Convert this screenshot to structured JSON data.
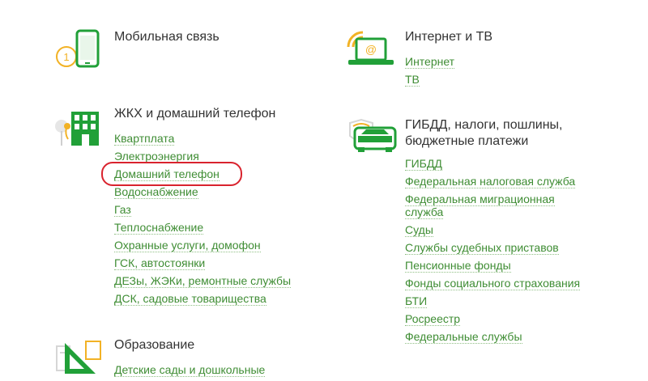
{
  "colors": {
    "accent": "#3f8d34",
    "icon_green": "#21a038",
    "icon_orange": "#f2b225",
    "highlight": "#d9232e",
    "title": "#333333"
  },
  "categories": {
    "mobile": {
      "title": "Мобильная связь",
      "icon": "mobile-phone-icon"
    },
    "internet": {
      "title": "Интернет и ТВ",
      "icon": "laptop-wifi-icon",
      "links": [
        "Интернет",
        "ТВ"
      ]
    },
    "housing": {
      "title": "ЖКХ и домашний телефон",
      "icon": "house-icon",
      "links": [
        "Квартплата",
        "Электроэнергия",
        "Домашний телефон",
        "Водоснабжение",
        "Газ",
        "Теплоснабжение",
        "Охранные услуги, домофон",
        "ГСК, автостоянки",
        "ДЕЗы, ЖЭКи, ремонтные службы",
        "ДСК, садовые товарищества"
      ],
      "highlighted_link": "Домашний телефон"
    },
    "gibdd": {
      "title_line1": "ГИБДД, налоги, пошлины,",
      "title_line2": "бюджетные платежи",
      "icon": "car-emblem-icon",
      "links": [
        "ГИБДД",
        "Федеральная налоговая служба",
        "Федеральная миграционная служба",
        "Суды",
        "Службы судебных приставов",
        "Пенсионные фонды",
        "Фонды социального страхования",
        "БТИ",
        "Росреестр",
        "Федеральные службы"
      ]
    },
    "education": {
      "title": "Образование",
      "icon": "ruler-triangle-icon",
      "links": [
        "Детские сады и дошкольные"
      ]
    }
  }
}
